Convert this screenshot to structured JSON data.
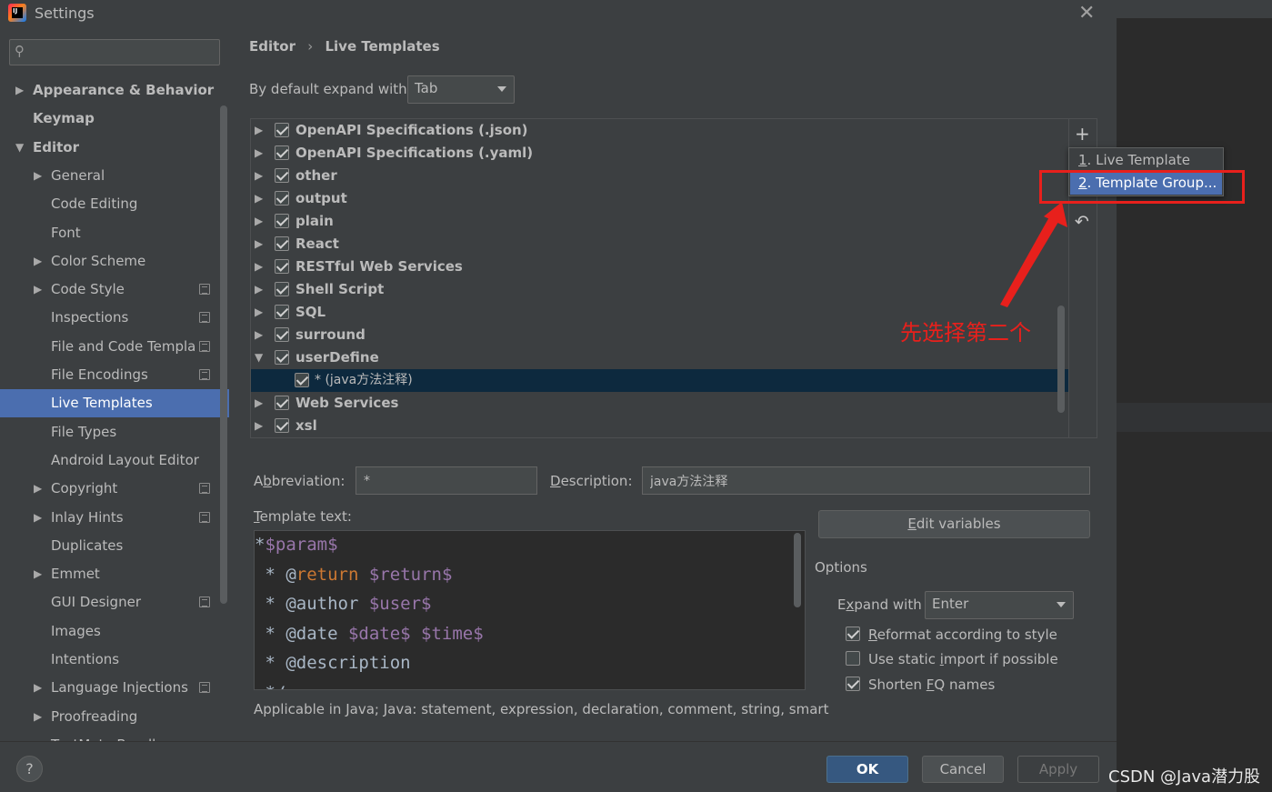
{
  "window": {
    "title": "Settings",
    "close_glyph": "✕"
  },
  "search": {
    "placeholder": "",
    "value": "",
    "icon": "search-icon"
  },
  "sidebar": {
    "items": [
      {
        "label": "Appearance & Behavior",
        "level": 0,
        "arrow": "▶",
        "bold": true
      },
      {
        "label": "Keymap",
        "level": 0,
        "arrow": "",
        "bold": true
      },
      {
        "label": "Editor",
        "level": 0,
        "arrow": "▼",
        "bold": true
      },
      {
        "label": "General",
        "level": 1,
        "arrow": "▶"
      },
      {
        "label": "Code Editing",
        "level": 1,
        "arrow": ""
      },
      {
        "label": "Font",
        "level": 1,
        "arrow": ""
      },
      {
        "label": "Color Scheme",
        "level": 1,
        "arrow": "▶"
      },
      {
        "label": "Code Style",
        "level": 1,
        "arrow": "▶",
        "project": true
      },
      {
        "label": "Inspections",
        "level": 1,
        "arrow": "",
        "project": true
      },
      {
        "label": "File and Code Templa",
        "level": 1,
        "arrow": "",
        "project": true
      },
      {
        "label": "File Encodings",
        "level": 1,
        "arrow": "",
        "project": true
      },
      {
        "label": "Live Templates",
        "level": 1,
        "arrow": "",
        "selected": true
      },
      {
        "label": "File Types",
        "level": 1,
        "arrow": ""
      },
      {
        "label": "Android Layout Editor",
        "level": 1,
        "arrow": ""
      },
      {
        "label": "Copyright",
        "level": 1,
        "arrow": "▶",
        "project": true
      },
      {
        "label": "Inlay Hints",
        "level": 1,
        "arrow": "▶",
        "project": true
      },
      {
        "label": "Duplicates",
        "level": 1,
        "arrow": ""
      },
      {
        "label": "Emmet",
        "level": 1,
        "arrow": "▶"
      },
      {
        "label": "GUI Designer",
        "level": 1,
        "arrow": "",
        "project": true
      },
      {
        "label": "Images",
        "level": 1,
        "arrow": ""
      },
      {
        "label": "Intentions",
        "level": 1,
        "arrow": ""
      },
      {
        "label": "Language Injections",
        "level": 1,
        "arrow": "▶",
        "project": true
      },
      {
        "label": "Proofreading",
        "level": 1,
        "arrow": "▶"
      },
      {
        "label": "TextMate Bundles",
        "level": 1,
        "arrow": ""
      }
    ]
  },
  "breadcrumb": {
    "parent": "Editor",
    "separator": "›",
    "current": "Live Templates"
  },
  "expand_default": {
    "label": "By default expand with",
    "value": "Tab"
  },
  "template_groups": [
    {
      "label": "OpenAPI Specifications (.json)",
      "checked": true,
      "arrow": "▶"
    },
    {
      "label": "OpenAPI Specifications (.yaml)",
      "checked": true,
      "arrow": "▶"
    },
    {
      "label": "other",
      "checked": true,
      "arrow": "▶"
    },
    {
      "label": "output",
      "checked": true,
      "arrow": "▶"
    },
    {
      "label": "plain",
      "checked": true,
      "arrow": "▶"
    },
    {
      "label": "React",
      "checked": true,
      "arrow": "▶"
    },
    {
      "label": "RESTful Web Services",
      "checked": true,
      "arrow": "▶"
    },
    {
      "label": "Shell Script",
      "checked": true,
      "arrow": "▶"
    },
    {
      "label": "SQL",
      "checked": true,
      "arrow": "▶"
    },
    {
      "label": "surround",
      "checked": true,
      "arrow": "▶"
    },
    {
      "label": "userDefine",
      "checked": true,
      "arrow": "▼"
    },
    {
      "label": "* (java方法注释)",
      "checked": true,
      "arrow": "",
      "child": true,
      "selected": true
    },
    {
      "label": "Web Services",
      "checked": true,
      "arrow": "▶"
    },
    {
      "label": "xsl",
      "checked": true,
      "arrow": "▶"
    }
  ],
  "toolbar": {
    "add_glyph": "+",
    "remove_glyph": "−",
    "revert_glyph": "↶"
  },
  "add_popup": {
    "items": [
      {
        "num": "1",
        "label": ". Live Template"
      },
      {
        "num": "2",
        "label": ". Template Group..."
      }
    ]
  },
  "annotation": {
    "text": "先选择第二个",
    "color": "#e8201c"
  },
  "abbreviation": {
    "label_pre": "A",
    "label_ul": "b",
    "label_post": "breviation:",
    "value": "*"
  },
  "description": {
    "label_ul": "D",
    "label_post": "escription:",
    "value": "java方法注释"
  },
  "template_text": {
    "label_ul": "T",
    "label_post": "emplate text:",
    "lines": [
      [
        {
          "t": "*",
          "c": ""
        },
        {
          "t": "$param$",
          "c": "var"
        }
      ],
      [
        {
          "t": " * ",
          "c": ""
        },
        {
          "t": "@",
          "c": ""
        },
        {
          "t": "return",
          "c": "kw"
        },
        {
          "t": " ",
          "c": ""
        },
        {
          "t": "$return$",
          "c": "var"
        }
      ],
      [
        {
          "t": " * @author ",
          "c": ""
        },
        {
          "t": "$user$",
          "c": "var"
        }
      ],
      [
        {
          "t": " * @date ",
          "c": ""
        },
        {
          "t": "$date$",
          "c": "var"
        },
        {
          "t": " ",
          "c": ""
        },
        {
          "t": "$time$",
          "c": "var"
        }
      ],
      [
        {
          "t": " * @description",
          "c": ""
        }
      ],
      [
        {
          "t": " */",
          "c": ""
        }
      ]
    ]
  },
  "edit_variables": {
    "label_ul": "E",
    "label_post": "dit variables"
  },
  "options": {
    "title": "Options",
    "expand_with_pre": "E",
    "expand_with_ul": "x",
    "expand_with_post": "pand with",
    "expand_with_value": "Enter",
    "checkboxes": [
      {
        "pre": "",
        "ul": "R",
        "post": "eformat according to style",
        "checked": true
      },
      {
        "pre": "Use static ",
        "ul": "i",
        "post": "mport if possible",
        "checked": false
      },
      {
        "pre": "Shorten ",
        "ul": "F",
        "post": "Q names",
        "checked": true
      }
    ]
  },
  "applicable": "Applicable in Java; Java: statement, expression, declaration, comment, string, smart",
  "buttons": {
    "ok": "OK",
    "cancel": "Cancel",
    "apply": "Apply",
    "help": "?"
  },
  "watermark": "CSDN @Java潜力股"
}
